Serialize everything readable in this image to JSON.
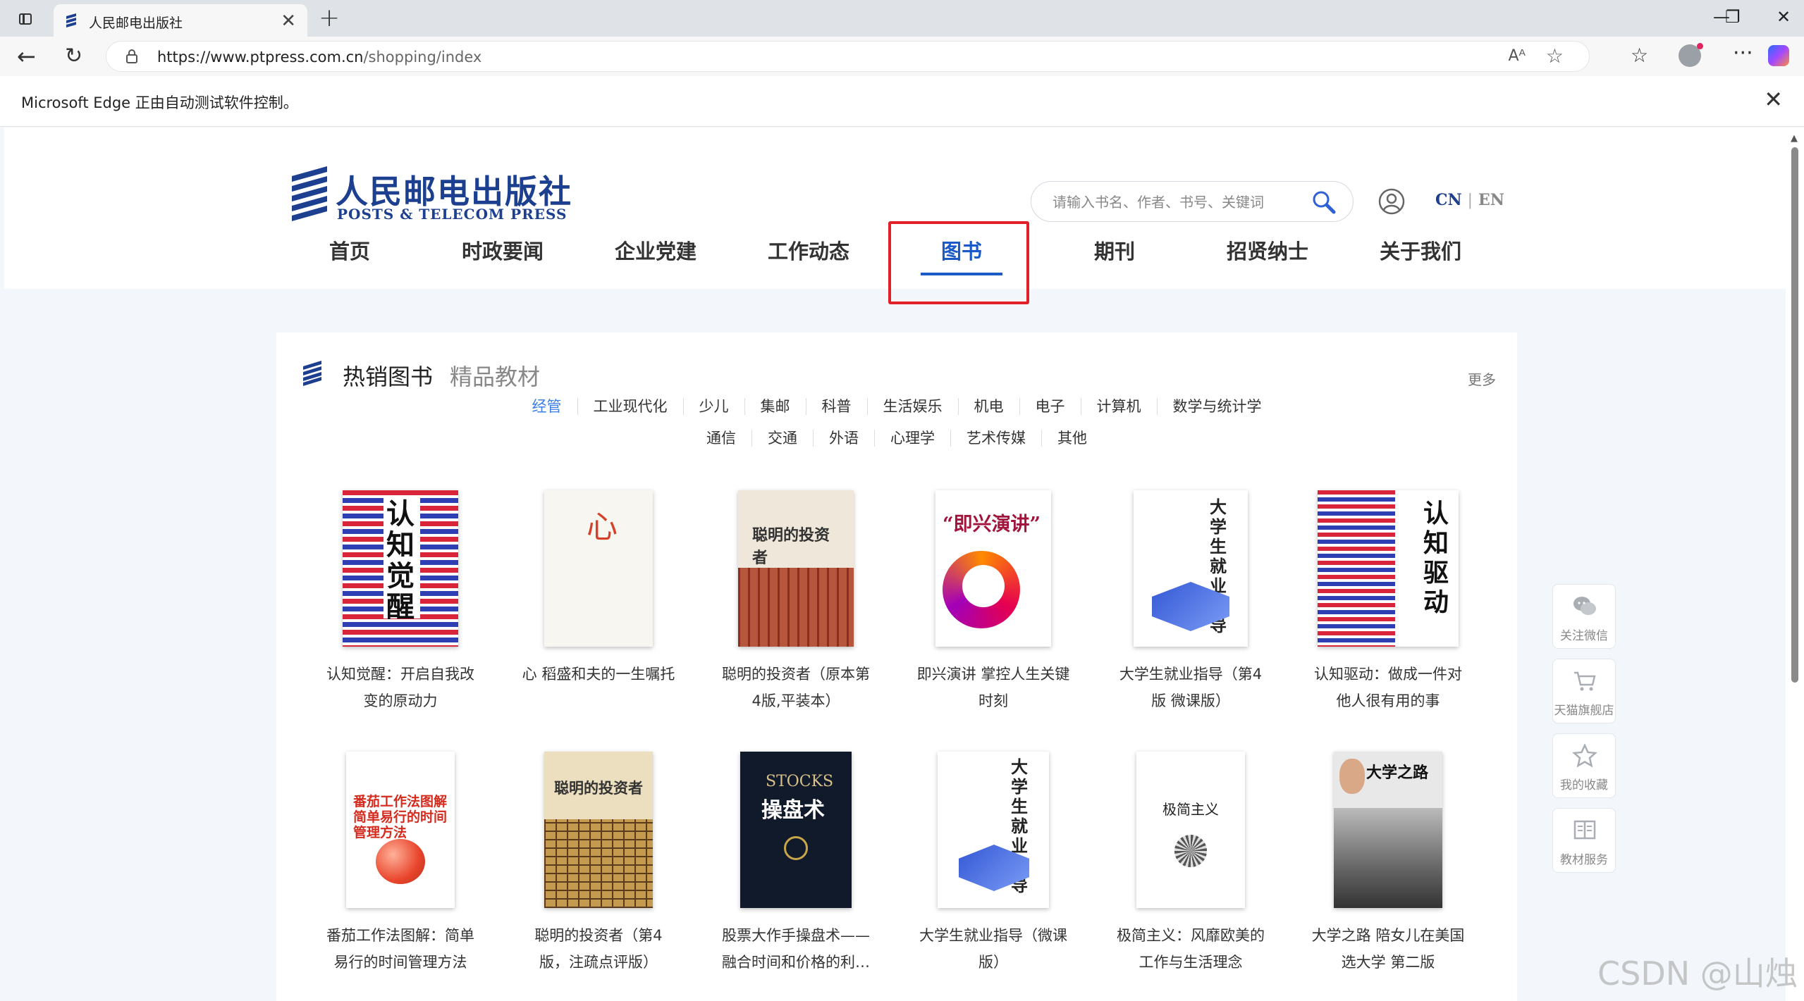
{
  "browser": {
    "tab_title": "人民邮电出版社",
    "url_host": "https://www.ptpress.com.cn",
    "url_path": "/shopping/index",
    "automation_notice": "Microsoft Edge 正由自动测试软件控制。"
  },
  "site": {
    "logo_cn": "人民邮电出版社",
    "logo_en": "POSTS & TELECOM PRESS",
    "search_placeholder": "请输入书名、作者、书号、关键词",
    "lang_cn": "CN",
    "lang_sep": "|",
    "lang_en": "EN",
    "nav": [
      "首页",
      "时政要闻",
      "企业党建",
      "工作动态",
      "图书",
      "期刊",
      "招贤纳士",
      "关于我们"
    ],
    "nav_active_index": 4
  },
  "section": {
    "tab_hot": "热销图书",
    "tab_textbook": "精品教材",
    "more": "更多",
    "categories_row1": [
      "经管",
      "工业现代化",
      "少儿",
      "集邮",
      "科普",
      "生活娱乐",
      "机电",
      "电子",
      "计算机",
      "数学与统计学"
    ],
    "categories_row2": [
      "通信",
      "交通",
      "外语",
      "心理学",
      "艺术传媒",
      "其他"
    ],
    "active_category": "经管",
    "books": [
      {
        "title_l1": "认知觉醒：开启自我改",
        "title_l2": "变的原动力",
        "cover_text": "认知觉醒"
      },
      {
        "title_l1": "心 稻盛和夫的一生嘱托",
        "title_l2": "",
        "cover_text": "心"
      },
      {
        "title_l1": "聪明的投资者（原本第",
        "title_l2": "4版,平装本）",
        "cover_text": "聪明的投资者"
      },
      {
        "title_l1": "即兴演讲 掌控人生关键",
        "title_l2": "时刻",
        "cover_text": "“即兴演讲”"
      },
      {
        "title_l1": "大学生就业指导（第4",
        "title_l2": "版 微课版）",
        "cover_text": "大学生就业指导"
      },
      {
        "title_l1": "认知驱动：做成一件对",
        "title_l2": "他人很有用的事",
        "cover_text": "认知驱动"
      },
      {
        "title_l1": "番茄工作法图解：简单",
        "title_l2": "易行的时间管理方法",
        "cover_text": "番茄工作法图解 简单易行的时间管理方法"
      },
      {
        "title_l1": "聪明的投资者（第4",
        "title_l2": "版，注疏点评版）",
        "cover_text": "聪明的投资者"
      },
      {
        "title_l1": "股票大作手操盘术——",
        "title_l2": "融合时间和价格的利…",
        "cover_text_1": "STOCKS",
        "cover_text_2": "操盘术"
      },
      {
        "title_l1": "大学生就业指导（微课",
        "title_l2": "版）",
        "cover_text": "大学生就业指导"
      },
      {
        "title_l1": "极简主义：风靡欧美的",
        "title_l2": "工作与生活理念",
        "cover_text": "极简主义"
      },
      {
        "title_l1": "大学之路 陪女儿在美国",
        "title_l2": "选大学 第二版",
        "cover_text": "大学之路"
      }
    ]
  },
  "float_bar": [
    "关注微信",
    "天猫旗舰店",
    "我的收藏",
    "教材服务"
  ],
  "watermark": "CSDN @山烛"
}
